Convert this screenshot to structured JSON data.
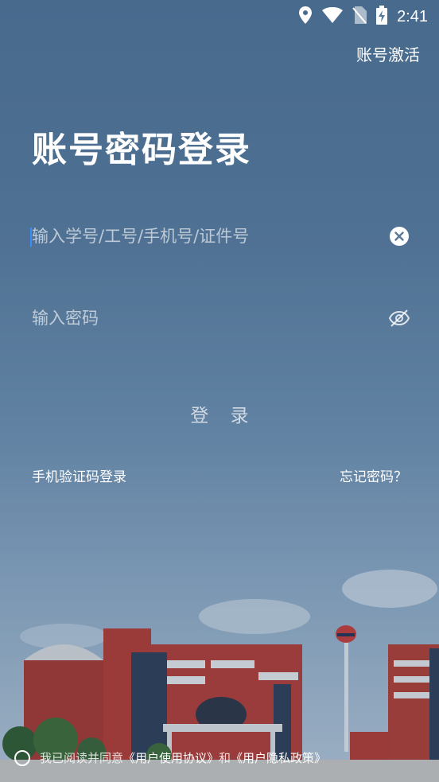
{
  "status_bar": {
    "time": "2:41",
    "icons": [
      "location-icon",
      "wifi-icon",
      "no-sim-icon",
      "battery-charging-icon"
    ]
  },
  "header": {
    "activate_label": "账号激活"
  },
  "login": {
    "title": "账号密码登录",
    "username_placeholder": "输入学号/工号/手机号/证件号",
    "password_placeholder": "输入密码",
    "login_button": "登 录",
    "sms_login": "手机验证码登录",
    "forgot_password": "忘记密码？"
  },
  "agreement": {
    "prefix": "我已阅读并同意",
    "user_agreement": "《用户使用协议》",
    "conjunction": "和",
    "privacy_policy": "《用户隐私政策》"
  },
  "colors": {
    "caret": "#3b8cff",
    "background_top": "#4f7294",
    "building_red": "#b4382e"
  }
}
